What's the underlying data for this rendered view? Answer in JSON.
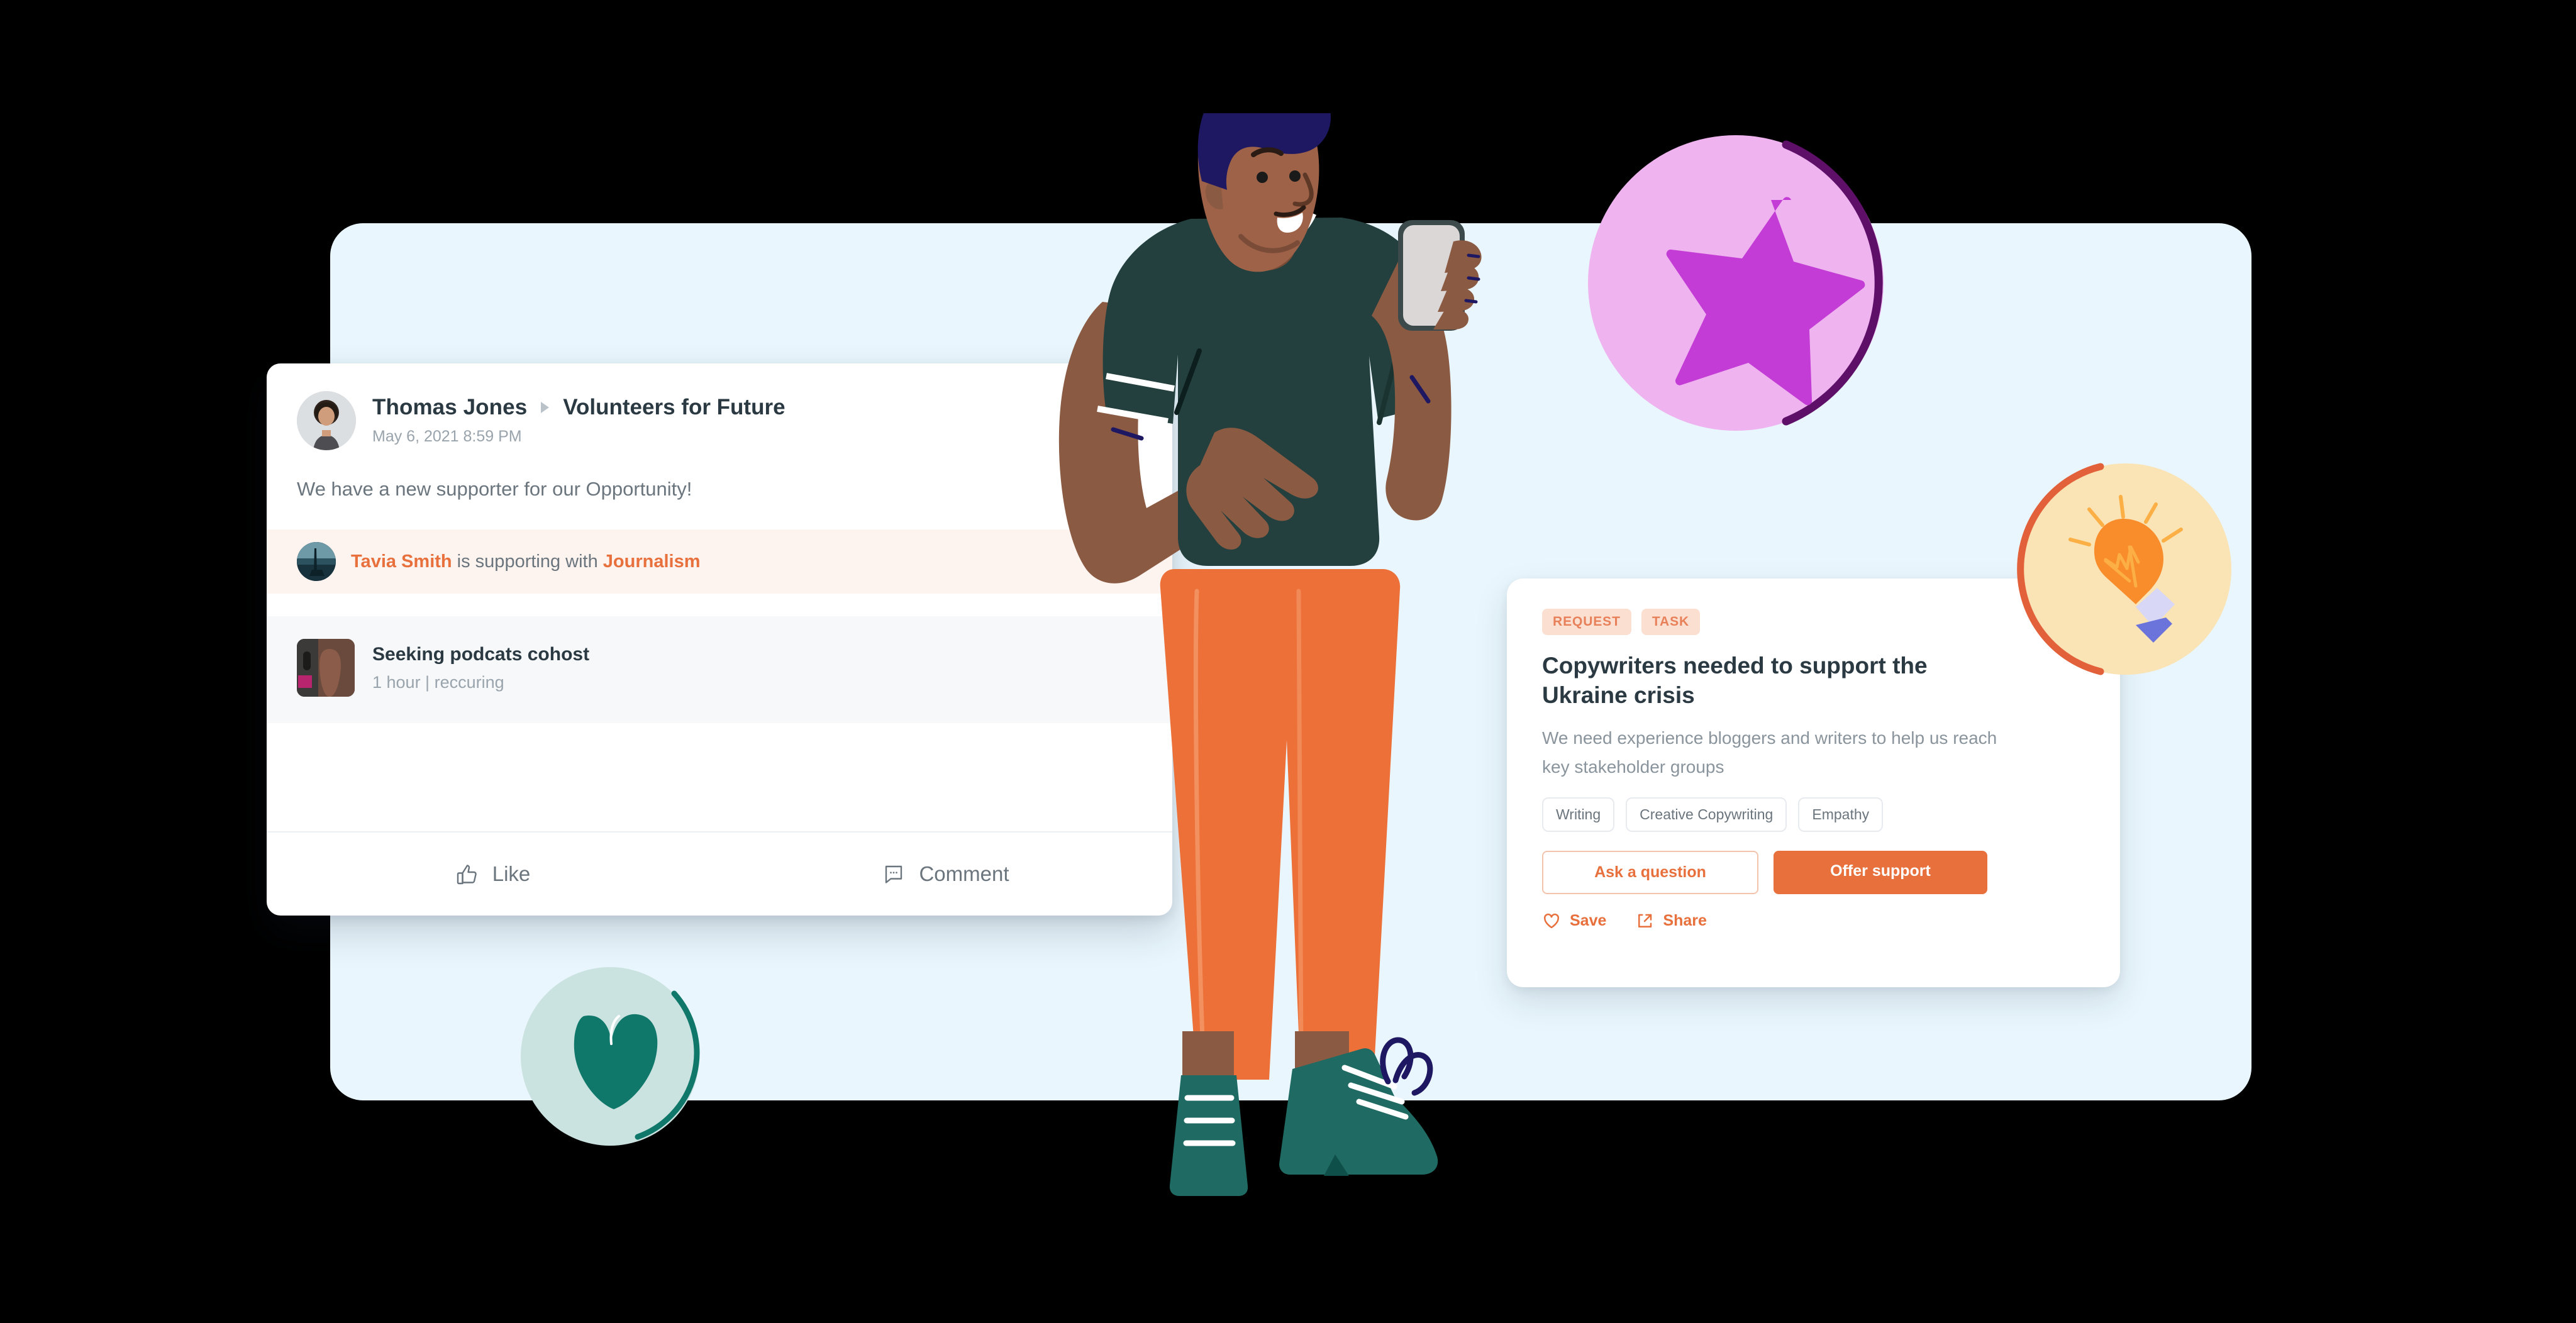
{
  "post": {
    "author": "Thomas Jones",
    "group": "Volunteers for Future",
    "timestamp": "May 6, 2021 8:59 PM",
    "body": "We have a new supporter for our Opportunity!",
    "supporter": {
      "name": "Tavia Smith",
      "middle": " is supporting with ",
      "skill": "Journalism"
    },
    "attachment": {
      "title": "Seeking podcats cohost",
      "meta": "1 hour | reccuring"
    },
    "actions": {
      "like": "Like",
      "comment": "Comment"
    }
  },
  "opportunity": {
    "chips": [
      "REQUEST",
      "TASK"
    ],
    "title": "Copywriters needed to support the Ukraine crisis",
    "description": "We need experience bloggers and writers to help us reach key stakeholder groups",
    "tags": [
      "Writing",
      "Creative Copywriting",
      "Empathy"
    ],
    "buttons": {
      "ask": "Ask a question",
      "offer": "Offer support"
    },
    "links": {
      "save": "Save",
      "share": "Share"
    }
  },
  "colors": {
    "panel_background": "#E9F6FD",
    "accent_orange": "#E8703C",
    "chip_background": "#FBDFD1",
    "chip_text": "#E8805A",
    "supporter_row_background": "#FDF3EF",
    "attachment_background": "#F6F8FA",
    "text_dark": "#2B3A42",
    "text_muted": "#8A949C",
    "star_badge_circle": "#EFB3F0",
    "star_badge_star": "#C43CD6",
    "star_badge_arc": "#5E1068",
    "bulb_badge_circle": "#FAE3B4",
    "bulb_badge_bulb": "#F98C2B",
    "bulb_badge_arc": "#E2603A",
    "heart_badge_circle": "#CBE3E0",
    "heart_badge_heart": "#10786A",
    "heart_badge_arc": "#10786A",
    "shirt": "#23403E",
    "pants": "#EC7038",
    "hair": "#1E1862",
    "skin": "#9E6248",
    "shoes": "#1F6A62"
  }
}
